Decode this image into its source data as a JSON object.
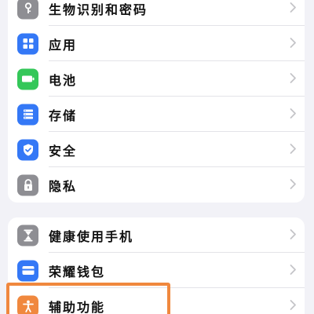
{
  "settings_group_1": {
    "items": [
      {
        "label": "生物识别和密码",
        "icon": "key-icon",
        "color": "#8e8e93"
      },
      {
        "label": "应用",
        "icon": "apps-grid-icon",
        "color": "#3478f6"
      },
      {
        "label": "电池",
        "icon": "battery-icon",
        "color": "#34c759"
      },
      {
        "label": "存储",
        "icon": "storage-list-icon",
        "color": "#3478f6"
      },
      {
        "label": "安全",
        "icon": "shield-check-icon",
        "color": "#3478f6"
      },
      {
        "label": "隐私",
        "icon": "privacy-lock-icon",
        "color": "#8e8e93"
      }
    ]
  },
  "settings_group_2": {
    "items": [
      {
        "label": "健康使用手机",
        "icon": "hourglass-icon",
        "color": "#8e8e93"
      },
      {
        "label": "荣耀钱包",
        "icon": "wallet-card-icon",
        "color": "#3478f6"
      },
      {
        "label": "辅助功能",
        "icon": "accessibility-person-icon",
        "color": "#f0883e"
      }
    ]
  },
  "highlight": {
    "color": "#f0883e",
    "target": "辅助功能"
  }
}
